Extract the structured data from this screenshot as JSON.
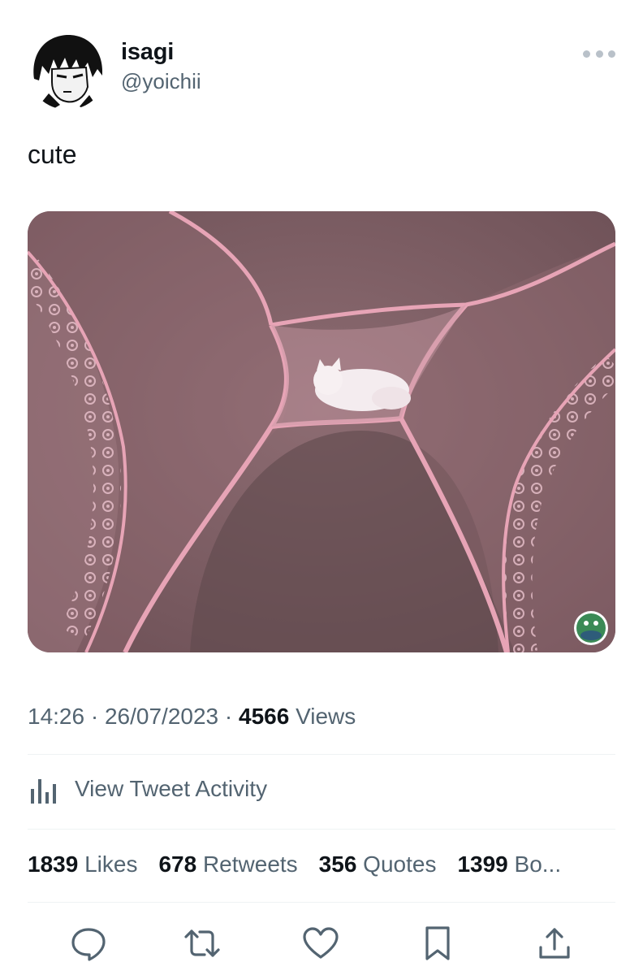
{
  "tweet": {
    "display_name": "isagi",
    "handle": "@yoichii",
    "text": "cute",
    "time": "14:26",
    "date": "26/07/2023",
    "views_count": "4566",
    "views_label": "Views",
    "separator": " · "
  },
  "activity": {
    "label": "View Tweet Activity",
    "icon": "analytics-bars-icon"
  },
  "stats": {
    "likes_count": "1839",
    "likes_label": "Likes",
    "retweets_count": "678",
    "retweets_label": "Retweets",
    "quotes_count": "356",
    "quotes_label": "Quotes",
    "bookmarks_count": "1399",
    "bookmarks_label": "Bo..."
  },
  "actions": {
    "icons": [
      "reply-icon",
      "retweet-icon",
      "like-icon",
      "bookmark-icon",
      "share-icon"
    ]
  },
  "colors": {
    "text_primary": "#0f1419",
    "text_secondary": "#536471",
    "divider": "#eff3f4",
    "photo_base": "#7d5e64",
    "mesh_pink": "#e7a4b6"
  }
}
